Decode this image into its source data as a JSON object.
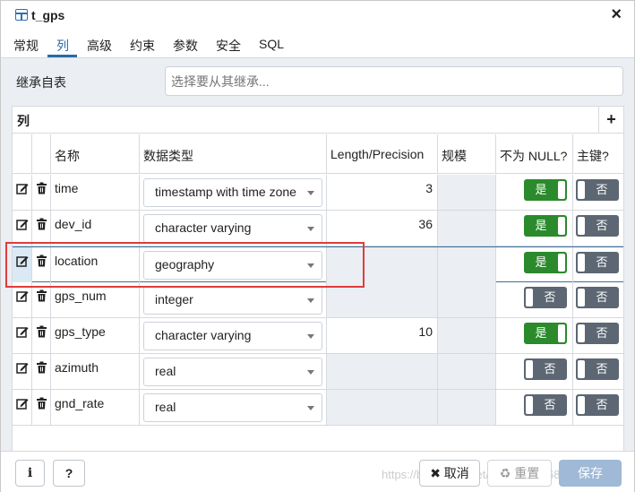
{
  "window": {
    "title": "t_gps",
    "close_label": "×"
  },
  "tabs": [
    {
      "label": "常规"
    },
    {
      "label": "列",
      "active": true
    },
    {
      "label": "高级"
    },
    {
      "label": "约束"
    },
    {
      "label": "参数"
    },
    {
      "label": "安全"
    },
    {
      "label": "SQL"
    }
  ],
  "inherit": {
    "label": "继承自表",
    "placeholder": "选择要从其继承..."
  },
  "grid": {
    "title": "列",
    "add_label": "+",
    "columns": [
      "名称",
      "数据类型",
      "Length/Precision",
      "规模",
      "不为 NULL?",
      "主键?"
    ],
    "rows": [
      {
        "name": "time",
        "type": "timestamp with time zone",
        "length": "3",
        "not_null": "是",
        "pk": "否"
      },
      {
        "name": "dev_id",
        "type": "character varying",
        "length": "36",
        "not_null": "是",
        "pk": "否"
      },
      {
        "name": "location",
        "type": "geography",
        "length": "",
        "not_null": "是",
        "pk": "否",
        "selected": true
      },
      {
        "name": "gps_num",
        "type": "integer",
        "length": "",
        "not_null": "否",
        "pk": "否"
      },
      {
        "name": "gps_type",
        "type": "character varying",
        "length": "10",
        "not_null": "是",
        "pk": "否"
      },
      {
        "name": "azimuth",
        "type": "real",
        "length": "",
        "not_null": "否",
        "pk": "否"
      },
      {
        "name": "gnd_rate",
        "type": "real",
        "length": "",
        "not_null": "否",
        "pk": "否"
      }
    ]
  },
  "footer": {
    "info_label": "i",
    "help_label": "?",
    "cancel_label": "✖ 取消",
    "reset_label": "♻ 重置",
    "save_label": "保存",
    "watermark": "https://blog.csdn.net/qq_40637168"
  },
  "colors": {
    "accent": "#2b6aa6",
    "yes": "#2b8a2c",
    "no": "#5c6773",
    "highlight": "#e03b3b"
  }
}
